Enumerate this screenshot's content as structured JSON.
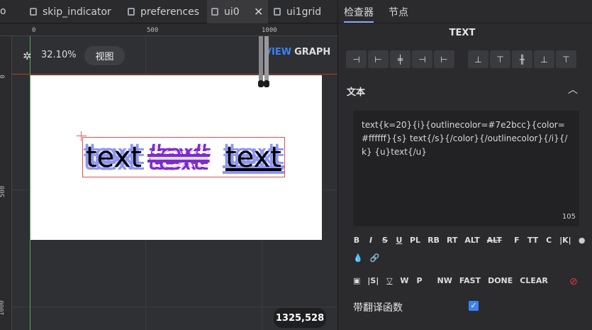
{
  "tabs": [
    {
      "label": "skip_indicator"
    },
    {
      "label": "preferences"
    },
    {
      "label": "ui0"
    },
    {
      "label": "ui1grid"
    }
  ],
  "tab_partial": "o",
  "canvas": {
    "zoom": "32.10%",
    "view_button": "视图",
    "view_word": "VIEW",
    "graph_word": "GRAPH",
    "coords": "1325,528",
    "ruler_top": [
      "0",
      "500",
      "1000"
    ],
    "ruler_left": [
      "0",
      "500",
      "1000"
    ],
    "words": [
      "text",
      "text",
      "text"
    ]
  },
  "panel": {
    "tabs": [
      "检查器",
      "节点"
    ],
    "title": "TEXT",
    "section": "文本",
    "text_value": "text{k=20}{i}{outlinecolor=#7e2bcc}{color=#ffffff}{s} text{/s}{/color}{/outlinecolor}{/i}{/k} {u}text{/u}",
    "char_count": "105",
    "toolbar_row1": [
      "B",
      "I",
      "S",
      "U",
      "PL",
      "RB",
      "RT",
      "ALT",
      "ALT",
      "F",
      "TT",
      "C",
      "|K|"
    ],
    "toolbar_row3": [
      "|S|",
      "W",
      "P",
      "NW",
      "FAST",
      "DONE",
      "CLEAR"
    ],
    "checkbox_label": "带翻译函数",
    "checkbox_checked": true
  }
}
